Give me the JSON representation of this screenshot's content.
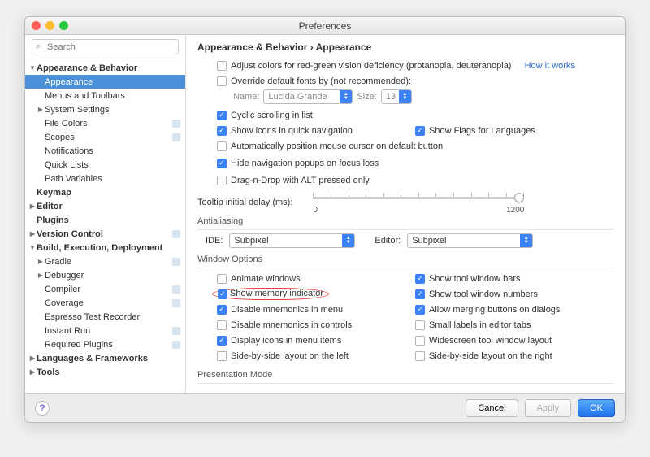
{
  "window": {
    "title": "Preferences"
  },
  "sidebar": {
    "search_placeholder": "Search",
    "items": [
      {
        "label": "Appearance & Behavior",
        "bold": true,
        "expanded": true,
        "level": 0
      },
      {
        "label": "Appearance",
        "level": 1,
        "selected": true
      },
      {
        "label": "Menus and Toolbars",
        "level": 1
      },
      {
        "label": "System Settings",
        "level": 1,
        "expandable": true
      },
      {
        "label": "File Colors",
        "level": 1,
        "marker": true
      },
      {
        "label": "Scopes",
        "level": 1,
        "marker": true
      },
      {
        "label": "Notifications",
        "level": 1
      },
      {
        "label": "Quick Lists",
        "level": 1
      },
      {
        "label": "Path Variables",
        "level": 1
      },
      {
        "label": "Keymap",
        "bold": true,
        "level": 0
      },
      {
        "label": "Editor",
        "bold": true,
        "level": 0,
        "expandable": true
      },
      {
        "label": "Plugins",
        "bold": true,
        "level": 0
      },
      {
        "label": "Version Control",
        "bold": true,
        "level": 0,
        "expandable": true,
        "marker": true
      },
      {
        "label": "Build, Execution, Deployment",
        "bold": true,
        "level": 0,
        "expanded": true
      },
      {
        "label": "Gradle",
        "level": 1,
        "expandable": true,
        "marker": true
      },
      {
        "label": "Debugger",
        "level": 1,
        "expandable": true
      },
      {
        "label": "Compiler",
        "level": 1,
        "marker": true
      },
      {
        "label": "Coverage",
        "level": 1,
        "marker": true
      },
      {
        "label": "Espresso Test Recorder",
        "level": 1
      },
      {
        "label": "Instant Run",
        "level": 1,
        "marker": true
      },
      {
        "label": "Required Plugins",
        "level": 1,
        "marker": true
      },
      {
        "label": "Languages & Frameworks",
        "bold": true,
        "level": 0,
        "expandable": true
      },
      {
        "label": "Tools",
        "bold": true,
        "level": 0,
        "expandable": true
      }
    ]
  },
  "main": {
    "breadcrumb": "Appearance & Behavior › Appearance",
    "opt_adjust_colors": "Adjust colors for red-green vision deficiency (protanopia, deuteranopia)",
    "how_it_works": "How it works",
    "opt_override_fonts": "Override default fonts by (not recommended):",
    "font_name_label": "Name:",
    "font_name_value": "Lucida Grande",
    "font_size_label": "Size:",
    "font_size_value": "13",
    "opt_cyclic": {
      "label": "Cyclic scrolling in list",
      "checked": true
    },
    "opt_icons_nav": {
      "label": "Show icons in quick navigation",
      "checked": true
    },
    "opt_flags": {
      "label": "Show Flags for Languages",
      "checked": true
    },
    "opt_cursor": {
      "label": "Automatically position mouse cursor on default button",
      "checked": false
    },
    "opt_hide_popups": {
      "label": "Hide navigation popups on focus loss",
      "checked": true
    },
    "opt_dnd": {
      "label": "Drag-n-Drop with ALT pressed only",
      "checked": false
    },
    "tooltip_label": "Tooltip initial delay (ms):",
    "slider_min": "0",
    "slider_max": "1200",
    "sec_antialiasing": "Antialiasing",
    "ide_label": "IDE:",
    "ide_value": "Subpixel",
    "editor_label": "Editor:",
    "editor_value": "Subpixel",
    "sec_window": "Window Options",
    "left_opts": [
      {
        "label": "Animate windows",
        "checked": false
      },
      {
        "label": "Show memory indicator",
        "checked": true,
        "highlight": true
      },
      {
        "label": "Disable mnemonics in menu",
        "checked": true
      },
      {
        "label": "Disable mnemonics in controls",
        "checked": false
      },
      {
        "label": "Display icons in menu items",
        "checked": true
      },
      {
        "label": "Side-by-side layout on the left",
        "checked": false
      }
    ],
    "right_opts": [
      {
        "label": "Show tool window bars",
        "checked": true
      },
      {
        "label": "Show tool window numbers",
        "checked": true
      },
      {
        "label": "Allow merging buttons on dialogs",
        "checked": true
      },
      {
        "label": "Small labels in editor tabs",
        "checked": false
      },
      {
        "label": "Widescreen tool window layout",
        "checked": false
      },
      {
        "label": "Side-by-side layout on the right",
        "checked": false
      }
    ],
    "sec_presentation": "Presentation Mode"
  },
  "footer": {
    "cancel": "Cancel",
    "apply": "Apply",
    "ok": "OK"
  }
}
